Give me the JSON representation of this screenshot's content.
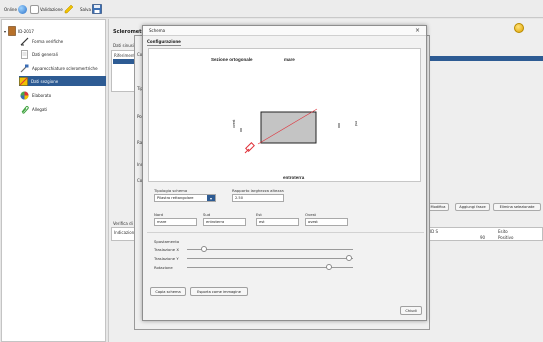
{
  "toolbar": {
    "items": [
      {
        "label": "Online",
        "icon": "globe-icon"
      },
      {
        "label": "Validazione",
        "icon": "check-icon"
      },
      {
        "label": "Salva",
        "icon": "floppy-disk-icon"
      }
    ]
  },
  "tree": {
    "root_label": "ID-2017",
    "items": [
      {
        "label": "Forma verifiche",
        "icon": "ruler-icon"
      },
      {
        "label": "Dati generali",
        "icon": "document-icon"
      },
      {
        "label": "Apparecchiature scleromertriche",
        "icon": "hammer-icon"
      },
      {
        "label": "Dati sezgione",
        "icon": "section-icon",
        "selected": true
      },
      {
        "label": "Elaborato",
        "icon": "pie-chart-icon"
      },
      {
        "label": "Allegati",
        "icon": "paperclip-icon"
      }
    ]
  },
  "main": {
    "title": "Sclerometrici",
    "bg_labels": [
      "Dati sinusi",
      "Riferimenti",
      "Verifica di",
      "Indicazione",
      "Contr",
      "Tipologia",
      "Posiz",
      "Ralo",
      "Indic",
      "Colo"
    ],
    "bg_buttons": [
      "Modifica",
      "Aggiungi fasce",
      "Elimina selezionate"
    ],
    "table_headers": [
      "ID S",
      "Esito"
    ],
    "table_row": {
      "value": "90",
      "esito": "Positivo"
    }
  },
  "dialog": {
    "title": "Schema",
    "tab": "Configurazione",
    "close_glyph": "×",
    "canvas": {
      "section_label": "Sezione ortogonale",
      "top_label": "mare",
      "left_label": "ovest",
      "right_label": "est",
      "bottom_label": "entroterra",
      "inside_label": "A"
    },
    "form": {
      "tipologia_label": "Tipologia schema",
      "tipologia_value": "Pilastro rettangolare",
      "rapporto_label": "Rapporto larghezza altezza",
      "rapporto_value": "2.50",
      "nord_label": "Nord",
      "nord_value": "mare",
      "sud_label": "Sud",
      "sud_value": "entroterra",
      "est_label": "Est",
      "est_value": "est",
      "ovest_label": "Ovest",
      "ovest_value": "ovest"
    },
    "spostamento": {
      "heading": "Spostamento",
      "traslazione_x": "Traslazione X",
      "traslazione_y": "Traslazione Y",
      "rotazione": "Rotazione"
    },
    "buttons": {
      "copy_schema": "Copia schema",
      "export_image": "Esporta come immagine",
      "close": "Chiudi"
    }
  },
  "colors": {
    "accent": "#2d5b93",
    "schema_rect": "#c4c4c4",
    "schema_border": "#222222",
    "marker_red": "#e0313a"
  }
}
